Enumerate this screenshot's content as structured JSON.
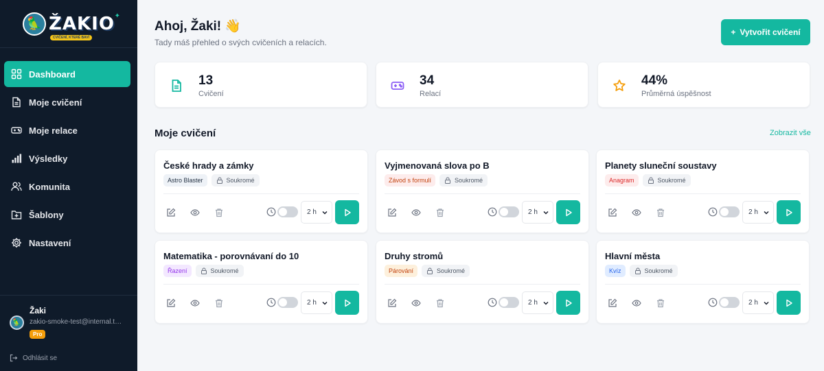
{
  "app": {
    "logo_text": "ŽAKIO",
    "logo_tagline": "CVIČENÍ, KTERÉ BAVÍ"
  },
  "sidebar": {
    "items": [
      {
        "label": "Dashboard",
        "icon": "grid-icon",
        "active": true
      },
      {
        "label": "Moje cvičení",
        "icon": "document-icon",
        "active": false
      },
      {
        "label": "Moje relace",
        "icon": "gamepad-icon",
        "active": false
      },
      {
        "label": "Výsledky",
        "icon": "bar-chart-icon",
        "active": false
      },
      {
        "label": "Komunita",
        "icon": "users-icon",
        "active": false
      },
      {
        "label": "Šablony",
        "icon": "folder-plus-icon",
        "active": false
      },
      {
        "label": "Nastavení",
        "icon": "gear-icon",
        "active": false
      }
    ],
    "user": {
      "name": "Žaki",
      "email": "zakio-smoke-test@internal.tes...",
      "badge": "Pro"
    },
    "logout_label": "Odhlásit se"
  },
  "header": {
    "greeting": "Ahoj, Žaki! 👋",
    "subtitle": "Tady máš přehled o svých cvičeních a relacích.",
    "create_button": "Vytvořit cvičení"
  },
  "stats": [
    {
      "value": "13",
      "label": "Cvičení",
      "icon": "document-icon",
      "color": "#14b8a0"
    },
    {
      "value": "34",
      "label": "Relací",
      "icon": "gamepad-icon",
      "color": "#8b5cf6"
    },
    {
      "value": "44%",
      "label": "Průměrná úspěšnost",
      "icon": "star-icon",
      "color": "#f59e0b"
    }
  ],
  "section": {
    "title": "Moje cvičení",
    "show_all": "Zobrazit vše"
  },
  "cards": [
    {
      "title": "České hrady a zámky",
      "tag": "Astro Blaster",
      "tag_bg": "#eef2f7",
      "tag_fg": "#1f2d3f",
      "privacy": "Soukromé",
      "duration": "2 h"
    },
    {
      "title": "Vyjmenovaná slova po B",
      "tag": "Závod s formulí",
      "tag_bg": "#fdecec",
      "tag_fg": "#c2410c",
      "privacy": "Soukromé",
      "duration": "2 h"
    },
    {
      "title": "Planety sluneční soustavy",
      "tag": "Anagram",
      "tag_bg": "#fdecec",
      "tag_fg": "#dc2626",
      "privacy": "Soukromé",
      "duration": "2 h"
    },
    {
      "title": "Matematika - porovnávaní do 10",
      "tag": "Řazení",
      "tag_bg": "#f3e8ff",
      "tag_fg": "#9333ea",
      "privacy": "Soukromé",
      "duration": "2 h"
    },
    {
      "title": "Druhy stromů",
      "tag": "Párování",
      "tag_bg": "#fdf0dc",
      "tag_fg": "#c2410c",
      "privacy": "Soukromé",
      "duration": "2 h"
    },
    {
      "title": "Hlavní města",
      "tag": "Kvíz",
      "tag_bg": "#e0ecff",
      "tag_fg": "#2563eb",
      "privacy": "Soukromé",
      "duration": "2 h"
    }
  ]
}
